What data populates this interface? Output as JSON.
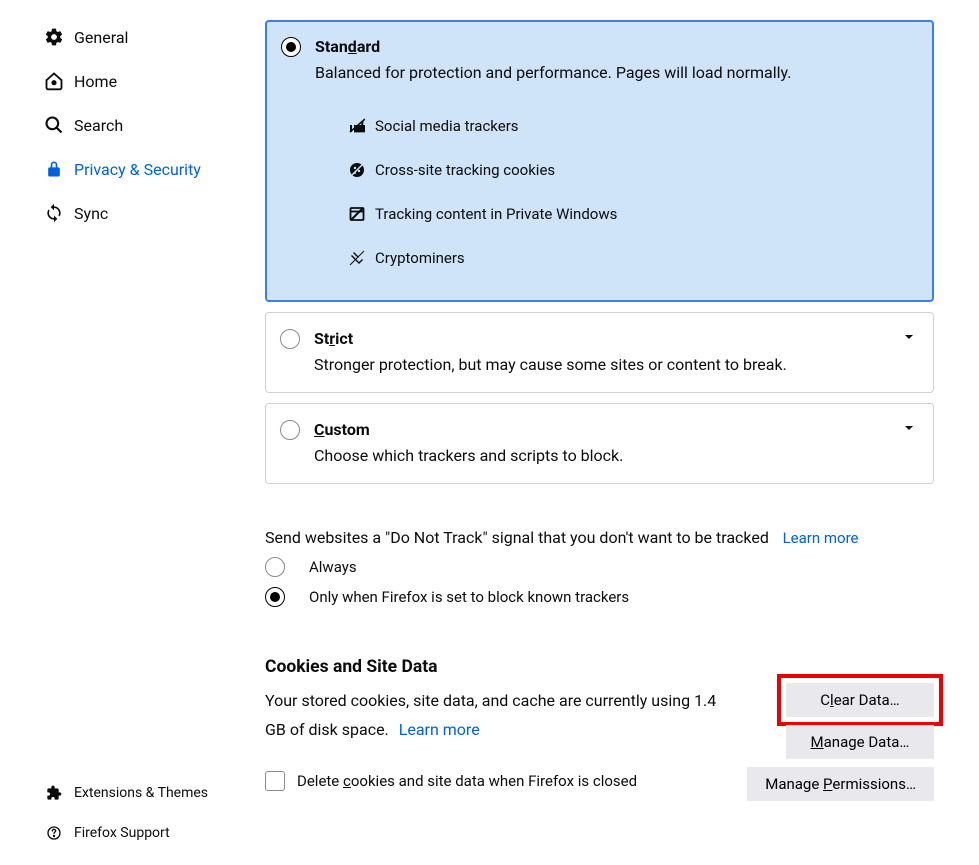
{
  "sidebar": {
    "items": [
      {
        "label": "General"
      },
      {
        "label": "Home"
      },
      {
        "label": "Search"
      },
      {
        "label": "Privacy & Security"
      },
      {
        "label": "Sync"
      }
    ],
    "bottom": [
      {
        "label": "Extensions & Themes"
      },
      {
        "label": "Firefox Support"
      }
    ]
  },
  "protection": {
    "standard": {
      "title_pre": "Stan",
      "title_u": "d",
      "title_post": "ard",
      "desc": "Balanced for protection and performance. Pages will load normally.",
      "trackers": [
        "Social media trackers",
        "Cross-site tracking cookies",
        "Tracking content in Private Windows",
        "Cryptominers"
      ]
    },
    "strict": {
      "title_pre": "St",
      "title_u": "r",
      "title_post": "ict",
      "desc": "Stronger protection, but may cause some sites or content to break."
    },
    "custom": {
      "title_pre": "",
      "title_u": "C",
      "title_post": "ustom",
      "desc": "Choose which trackers and scripts to block."
    }
  },
  "dnt": {
    "text": "Send websites a \"Do Not Track\" signal that you don't want to be tracked",
    "learn_more": "Learn more",
    "always": "Always",
    "only_when": "Only when Firefox is set to block known trackers"
  },
  "cookies": {
    "heading": "Cookies and Site Data",
    "desc_pre": "Your stored cookies, site data, and cache are currently using 1.4 GB of disk space.",
    "learn_more": "Learn more",
    "clear_pre": "C",
    "clear_u": "l",
    "clear_post": "ear Data…",
    "manage_pre": "",
    "manage_u": "M",
    "manage_post": "anage Data…",
    "perms_pre": "Manage ",
    "perms_u": "P",
    "perms_post": "ermissions…",
    "delete_pre": "Delete ",
    "delete_u": "c",
    "delete_post": "ookies and site data when Firefox is closed"
  }
}
